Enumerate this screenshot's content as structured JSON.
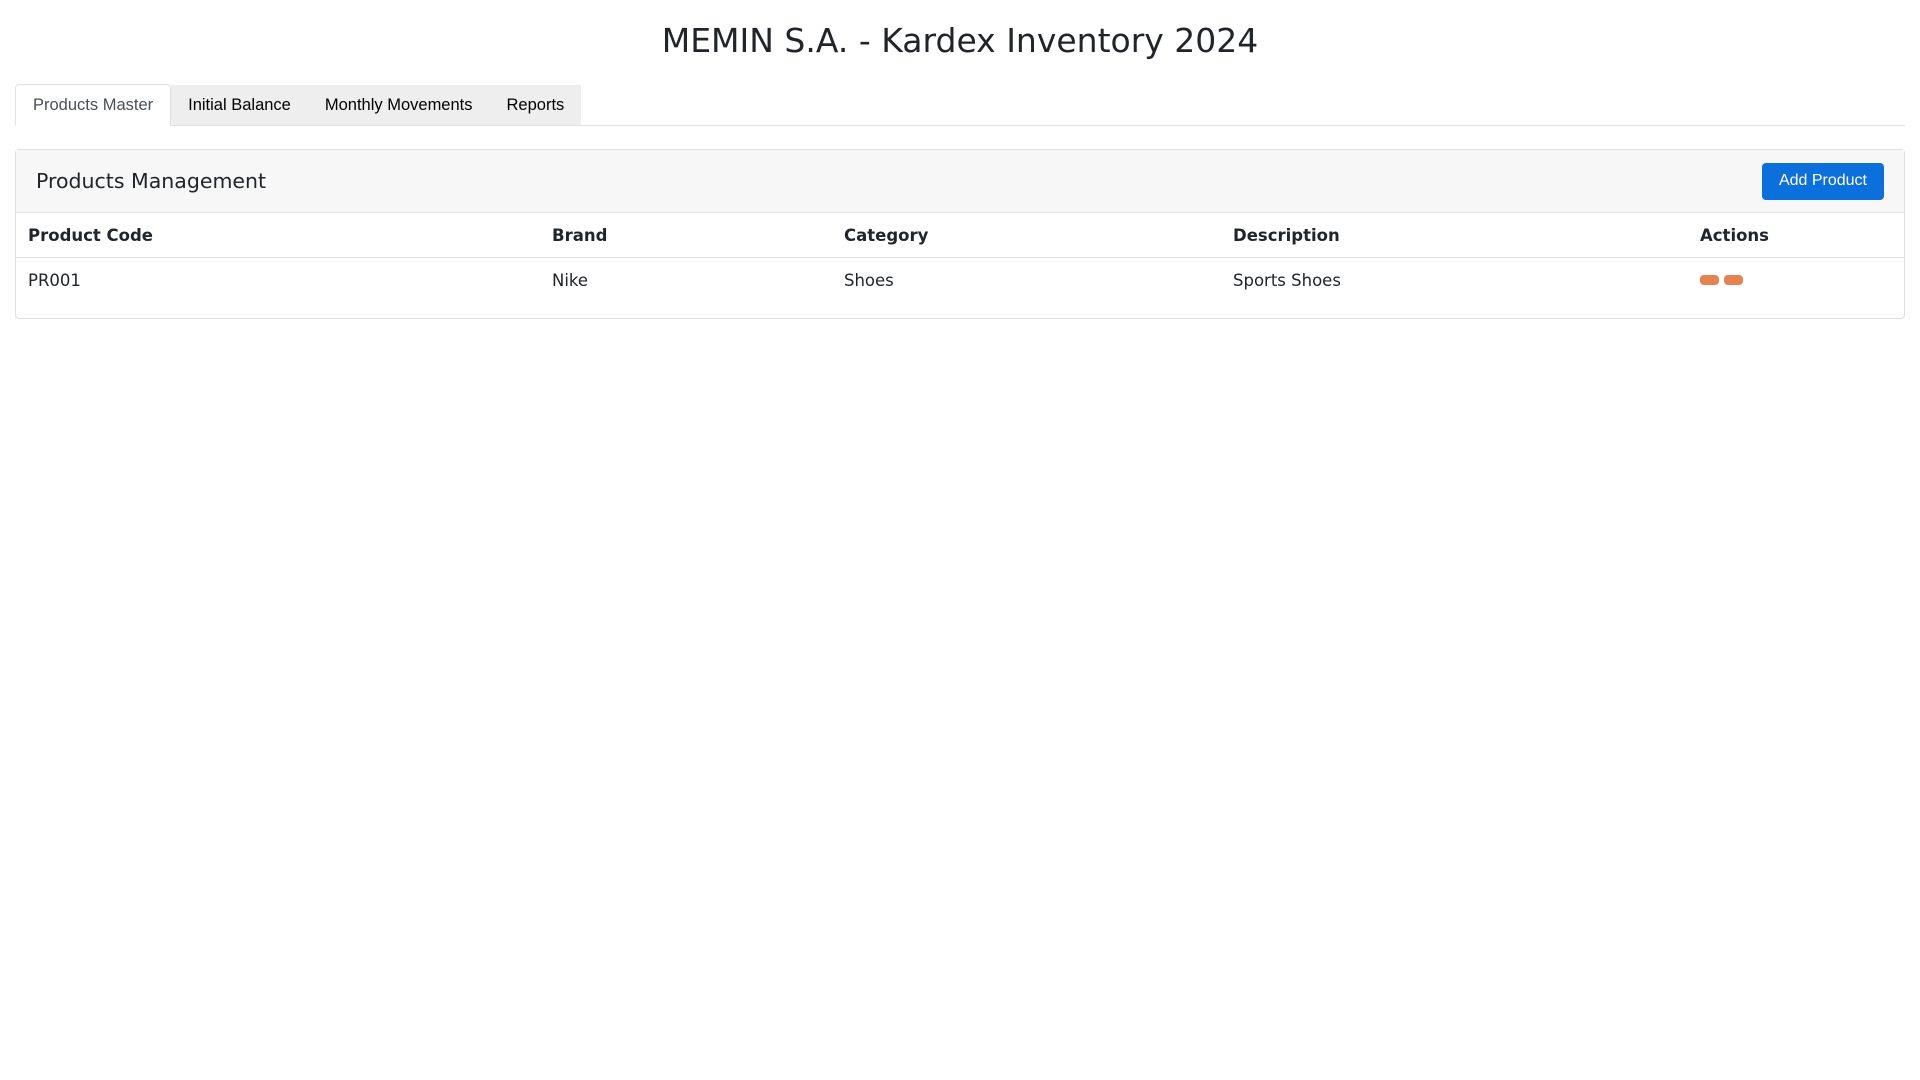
{
  "header": {
    "title": "MEMIN S.A. - Kardex Inventory 2024"
  },
  "tabs": [
    {
      "label": "Products Master",
      "active": true
    },
    {
      "label": "Initial Balance",
      "active": false
    },
    {
      "label": "Monthly Movements",
      "active": false
    },
    {
      "label": "Reports",
      "active": false
    }
  ],
  "products": {
    "title": "Products Management",
    "add_label": "Add Product",
    "columns": [
      "Product Code",
      "Brand",
      "Category",
      "Description",
      "Actions"
    ],
    "rows": [
      {
        "code": "PR001",
        "brand": "Nike",
        "category": "Shoes",
        "description": "Sports Shoes",
        "actions": [
          "edit",
          "delete"
        ]
      }
    ]
  },
  "colors": {
    "primary": "#0b6fdc",
    "action": "#e5824f"
  }
}
